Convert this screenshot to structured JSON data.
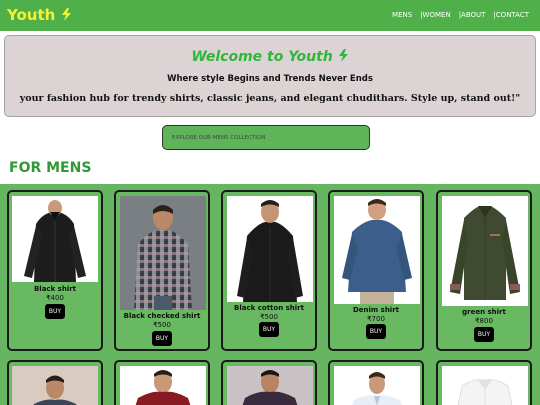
{
  "brand": {
    "name": "Youth",
    "icon": "lightning-icon",
    "color": "#f6f232"
  },
  "nav": [
    {
      "label": "MENS"
    },
    {
      "label": "|WOMEN"
    },
    {
      "label": "|ABOUT"
    },
    {
      "label": "|CONTACT"
    }
  ],
  "hero": {
    "title": "Welcome to Youth",
    "subtitle": "Where style Begins and Trends Never Ends",
    "tagline": "your fashion hub for trendy shirts, classic jeans, and elegant chudithars. Style up, stand out!\""
  },
  "search": {
    "placeholder": "EXPLORE OUR MENS COLLECTION"
  },
  "section": {
    "title": "FOR MENS"
  },
  "products": [
    {
      "name": "Black shirt",
      "price": "₹400",
      "buy": "BUY",
      "image": "black shirt photo"
    },
    {
      "name": "Black checked shirt",
      "price": "₹500",
      "buy": "BUY",
      "image": "checked shirt photo"
    },
    {
      "name": "Black cotton shirt",
      "price": "₹500",
      "buy": "BUY",
      "image": "cotton shirt photo"
    },
    {
      "name": "Denim shirt",
      "price": "₹700",
      "buy": "BUY",
      "image": "denim shirt photo"
    },
    {
      "name": "green shirt",
      "price": "₹800",
      "buy": "BUY",
      "image": "green shirt photo"
    }
  ],
  "colors": {
    "navbar": "#4fb04a",
    "accent": "#2eb73a",
    "panel": "#66b560"
  }
}
